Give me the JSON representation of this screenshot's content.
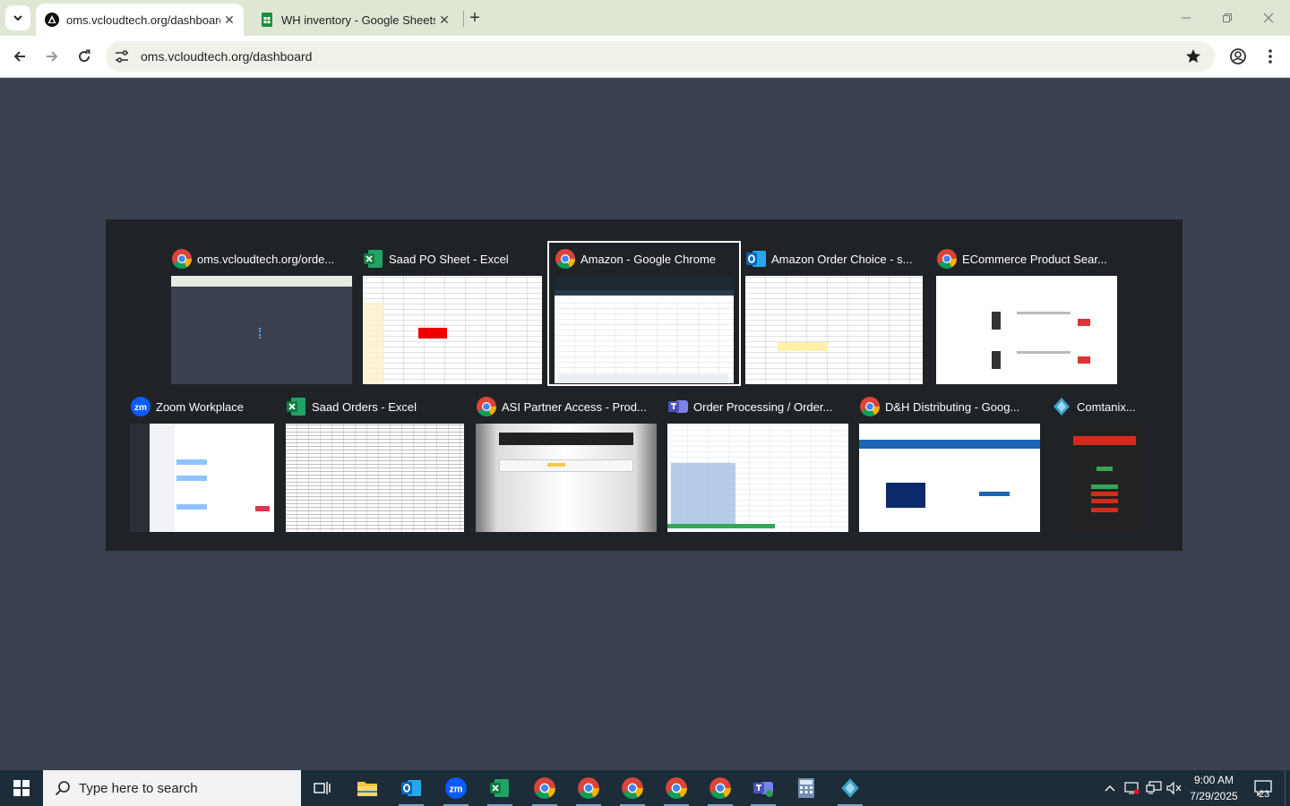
{
  "browser": {
    "tabs": [
      {
        "title": "oms.vcloudtech.org/dashboard",
        "active": true
      },
      {
        "title": "WH inventory - Google Sheets",
        "active": false
      }
    ],
    "url": "oms.vcloudtech.org/dashboard"
  },
  "switcher": {
    "windows": [
      {
        "title": "oms.vcloudtech.org/orde...",
        "app_icon": "chrome-icon"
      },
      {
        "title": "Saad PO Sheet - Excel",
        "app_icon": "excel-icon"
      },
      {
        "title": "Amazon - Google Chrome",
        "app_icon": "chrome-icon",
        "selected": true
      },
      {
        "title": "Amazon Order Choice - s...",
        "app_icon": "outlook-icon"
      },
      {
        "title": "ECommerce Product Sear...",
        "app_icon": "chrome-icon"
      },
      {
        "title": "Zoom Workplace",
        "app_icon": "zoom-icon"
      },
      {
        "title": "Saad Orders - Excel",
        "app_icon": "excel-icon"
      },
      {
        "title": "ASI Partner Access - Prod...",
        "app_icon": "chrome-icon"
      },
      {
        "title": "Order Processing / Order...",
        "app_icon": "teams-icon"
      },
      {
        "title": "D&H Distributing - Goog...",
        "app_icon": "chrome-icon"
      },
      {
        "title": "Comtanix...",
        "app_icon": "comtanix-icon"
      }
    ]
  },
  "taskbar": {
    "search_placeholder": "Type here to search",
    "time": "9:00 AM",
    "date": "7/29/2025",
    "notifications": "23"
  },
  "colors": {
    "desktop_bg": "#3a4151",
    "tabbar_bg": "#dfe7d4",
    "switcher_bg": "#1f2227",
    "taskbar_bg": "#1c2c38"
  }
}
